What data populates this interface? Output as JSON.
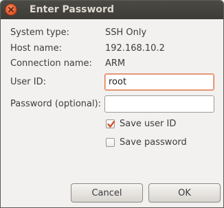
{
  "window": {
    "title": "Enter Password"
  },
  "info": {
    "system_type_label": "System type:",
    "system_type_value": "SSH Only",
    "host_name_label": "Host name:",
    "host_name_value": "192.168.10.2",
    "connection_name_label": "Connection name:",
    "connection_name_value": "ARM"
  },
  "form": {
    "user_id_label": "User ID:",
    "user_id_value": "root",
    "password_label": "Password (optional):",
    "password_value": "",
    "save_user_id_label": "Save user ID",
    "save_user_id_checked": true,
    "save_password_label": "Save password",
    "save_password_checked": false
  },
  "buttons": {
    "cancel_label": "Cancel",
    "ok_label": "OK"
  },
  "icons": {
    "close": "close-icon",
    "checkmark": "checkmark-icon"
  },
  "colors": {
    "titlebar": "#3d3c37",
    "close_button": "#e35a2c",
    "focus_border": "#e07a50",
    "check_mark": "#d24a1e"
  }
}
